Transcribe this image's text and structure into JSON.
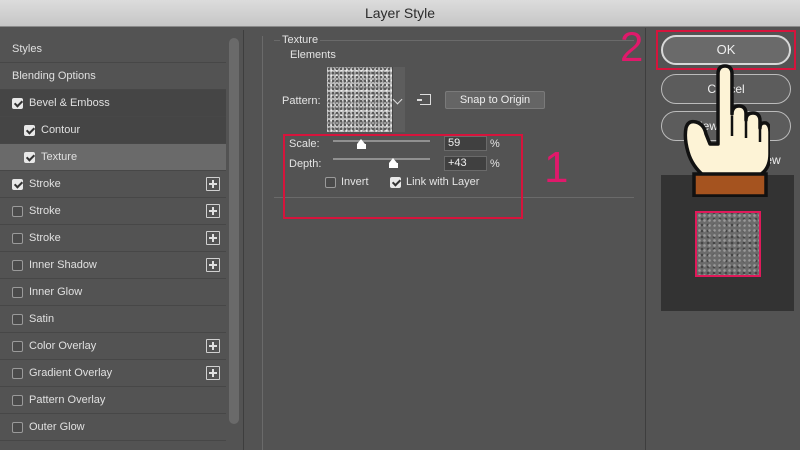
{
  "window": {
    "title": "Layer Style"
  },
  "sidebar": {
    "items": [
      {
        "label": "Styles"
      },
      {
        "label": "Blending Options"
      },
      {
        "label": "Bevel & Emboss"
      },
      {
        "label": "Contour"
      },
      {
        "label": "Texture"
      },
      {
        "label": "Stroke"
      },
      {
        "label": "Stroke"
      },
      {
        "label": "Stroke"
      },
      {
        "label": "Inner Shadow"
      },
      {
        "label": "Inner Glow"
      },
      {
        "label": "Satin"
      },
      {
        "label": "Color Overlay"
      },
      {
        "label": "Gradient Overlay"
      },
      {
        "label": "Pattern Overlay"
      },
      {
        "label": "Outer Glow"
      }
    ]
  },
  "texture": {
    "group_title": "Texture",
    "section_title": "Elements",
    "pattern_label": "Pattern:",
    "snap_button": "Snap to Origin",
    "scale_label": "Scale:",
    "scale_value": "59",
    "scale_unit": "%",
    "scale_level": 0.59,
    "depth_label": "Depth:",
    "depth_value": "+43",
    "depth_unit": "%",
    "invert_label": "Invert",
    "invert_checked": false,
    "link_label": "Link with Layer",
    "link_checked": true
  },
  "buttons": {
    "ok": "OK",
    "cancel": "Cancel",
    "new_style": "New Style...",
    "preview": "Preview"
  },
  "annotations": {
    "step1": "1",
    "step2": "2",
    "highlight_color": "#d6143c",
    "number_color": "#e0196b"
  },
  "icons": {
    "hand": "pointing-hand-icon",
    "plus": "plus-square-icon",
    "checkbox": "checkbox-icon",
    "new_preset": "new-preset-icon",
    "dropdown": "chevron-down-icon"
  }
}
